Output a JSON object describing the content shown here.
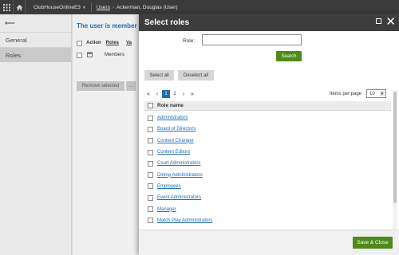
{
  "topbar": {
    "site_name": "ClubHouseOnlineE3",
    "breadcrumb_link": "Users",
    "breadcrumb_current": "Ackerman, Douglas (User)"
  },
  "leftnav": {
    "items": [
      {
        "label": "General"
      },
      {
        "label": "Roles"
      }
    ]
  },
  "page": {
    "heading": "The user is member o",
    "columns": [
      "Action",
      "Roles",
      "Va"
    ],
    "rows": [
      {
        "role": "Members"
      }
    ],
    "remove_selected_label": "Remove selected",
    "more_label": "..."
  },
  "dialog": {
    "title": "Select roles",
    "filter_label": "Role:",
    "filter_value": "",
    "search_label": "Search",
    "select_all_label": "Select all",
    "deselect_all_label": "Deselect all",
    "pager": {
      "current_page": "1",
      "next_page": "2",
      "items_per_page_label": "Items per page",
      "items_per_page_value": "10"
    },
    "grid_header": "Role name",
    "roles": [
      "Administrators",
      "Board of Directors",
      "Content Changer",
      "Content Editors",
      "Court Administrators",
      "Dining Administrators",
      "Employees",
      "Event Administrators",
      "Manager",
      "Match Play Administrators"
    ],
    "save_close_label": "Save & Close"
  },
  "colors": {
    "accent_blue": "#1f6eb3",
    "button_green": "#4f8a1c",
    "topbar_bg": "#3b3b3b"
  }
}
